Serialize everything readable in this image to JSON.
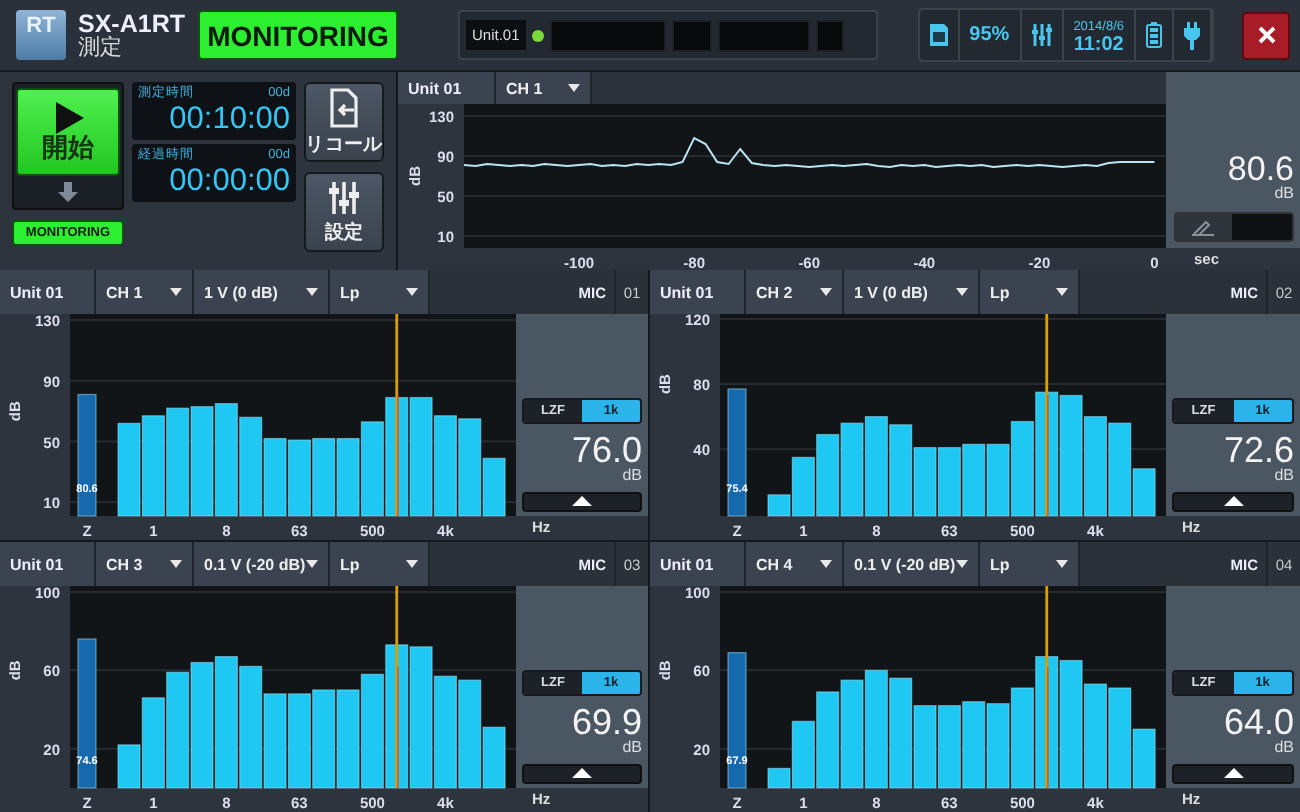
{
  "header": {
    "logo_text": "RT",
    "model": "SX-A1RT",
    "mode": "測定",
    "status_button": "MONITORING",
    "unit_label": "Unit.01",
    "unit_connected": true,
    "storage": "95%",
    "date": "2014/8/6",
    "time": "11:02"
  },
  "control": {
    "start_label": "開始",
    "status_badge": "MONITORING",
    "timers": [
      {
        "label": "測定時間",
        "days": "00d",
        "value": "00:10:00"
      },
      {
        "label": "経過時間",
        "days": "00d",
        "value": "00:00:00"
      }
    ],
    "buttons": [
      {
        "kind": "recall",
        "label": "リコール"
      },
      {
        "kind": "settings",
        "label": "設定"
      }
    ]
  },
  "trend": {
    "unit": "Unit 01",
    "channel": "CH 1",
    "reading": "80.6",
    "reading_unit": "dB",
    "chart_data": {
      "type": "line",
      "ylabel": "dB",
      "xlabel": "sec",
      "xlim": [
        -120,
        2
      ],
      "grid": true,
      "ylim": [
        -2,
        142
      ],
      "yticks": [
        10,
        50,
        90,
        130
      ],
      "xticks": [
        -100,
        -80,
        -60,
        -40,
        -20,
        0
      ],
      "x": [
        -120,
        -118,
        -116,
        -114,
        -112,
        -110,
        -108,
        -106,
        -104,
        -102,
        -100,
        -98,
        -96,
        -94,
        -92,
        -90,
        -88,
        -86,
        -84,
        -82,
        -80,
        -78,
        -76,
        -74,
        -72,
        -70,
        -68,
        -66,
        -64,
        -62,
        -60,
        -58,
        -56,
        -54,
        -52,
        -50,
        -48,
        -46,
        -44,
        -42,
        -40,
        -38,
        -36,
        -34,
        -32,
        -30,
        -28,
        -26,
        -24,
        -22,
        -20,
        -18,
        -16,
        -14,
        -12,
        -10,
        -8,
        -6,
        -4,
        -2,
        0
      ],
      "values": [
        81,
        80,
        82,
        81,
        80,
        81,
        80,
        82,
        81,
        80,
        81,
        82,
        80,
        81,
        80,
        82,
        81,
        82,
        81,
        84,
        108,
        102,
        84,
        82,
        97,
        83,
        81,
        80,
        81,
        80,
        79,
        80,
        81,
        80,
        81,
        82,
        80,
        79,
        81,
        80,
        81,
        79,
        80,
        81,
        80,
        81,
        79,
        80,
        81,
        80,
        81,
        80,
        79,
        80,
        81,
        80,
        83,
        84,
        84,
        84,
        84
      ]
    }
  },
  "panels": [
    {
      "unit": "Unit 01",
      "channel": "CH 1",
      "range": "1 V (0 dB)",
      "weighting": "Lp",
      "input": "MIC",
      "number": "01",
      "filters": [
        {
          "label": "LZF",
          "selected": false
        },
        {
          "label": "1k",
          "selected": true
        }
      ],
      "reading": "76.0",
      "reading_unit": "dB",
      "chart_data": {
        "type": "bar",
        "ylabel": "dB",
        "xlabel": "Hz",
        "ylim": [
          1,
          134
        ],
        "yticks": [
          10,
          50,
          90,
          130
        ],
        "categories": [
          "Z",
          null,
          "1",
          null,
          null,
          "8",
          null,
          null,
          "63",
          null,
          null,
          "500",
          null,
          null,
          "4k",
          null,
          null
        ],
        "values": [
          81,
          62,
          67,
          72,
          73,
          75,
          66,
          52,
          51,
          52,
          52,
          63,
          79,
          79,
          67,
          65,
          39
        ],
        "grid": true,
        "annotations": [
          "80.6"
        ]
      }
    },
    {
      "unit": "Unit 01",
      "channel": "CH 2",
      "range": "1 V (0 dB)",
      "weighting": "Lp",
      "input": "MIC",
      "number": "02",
      "filters": [
        {
          "label": "LZF",
          "selected": false
        },
        {
          "label": "1k",
          "selected": true
        }
      ],
      "reading": "72.6",
      "reading_unit": "dB",
      "chart_data": {
        "type": "bar",
        "ylabel": "dB",
        "xlabel": "Hz",
        "ylim": [
          -1,
          123
        ],
        "yticks": [
          40,
          80,
          120
        ],
        "categories": [
          "Z",
          null,
          "1",
          null,
          null,
          "8",
          null,
          null,
          "63",
          null,
          null,
          "500",
          null,
          null,
          "4k",
          null,
          null
        ],
        "values": [
          77,
          12,
          35,
          49,
          56,
          60,
          55,
          41,
          41,
          43,
          43,
          57,
          75,
          73,
          60,
          56,
          28
        ],
        "grid": true,
        "annotations": [
          "75.4"
        ]
      }
    },
    {
      "unit": "Unit 01",
      "channel": "CH 3",
      "range": "0.1 V (-20 dB)",
      "weighting": "Lp",
      "input": "MIC",
      "number": "03",
      "filters": [
        {
          "label": "LZF",
          "selected": false
        },
        {
          "label": "1k",
          "selected": true
        }
      ],
      "reading": "69.9",
      "reading_unit": "dB",
      "chart_data": {
        "type": "bar",
        "ylabel": "dB",
        "xlabel": "Hz",
        "ylim": [
          0,
          103
        ],
        "yticks": [
          20,
          60,
          100
        ],
        "categories": [
          "Z",
          null,
          "1",
          null,
          null,
          "8",
          null,
          null,
          "63",
          null,
          null,
          "500",
          null,
          null,
          "4k",
          null,
          null
        ],
        "values": [
          76,
          22,
          46,
          59,
          64,
          67,
          62,
          48,
          48,
          50,
          50,
          58,
          73,
          72,
          57,
          55,
          31
        ],
        "grid": true,
        "annotations": [
          "74.6"
        ]
      }
    },
    {
      "unit": "Unit 01",
      "channel": "CH 4",
      "range": "0.1 V (-20 dB)",
      "weighting": "Lp",
      "input": "MIC",
      "number": "04",
      "filters": [
        {
          "label": "LZF",
          "selected": false
        },
        {
          "label": "1k",
          "selected": true
        }
      ],
      "reading": "64.0",
      "reading_unit": "dB",
      "chart_data": {
        "type": "bar",
        "ylabel": "dB",
        "xlabel": "Hz",
        "ylim": [
          0,
          103
        ],
        "yticks": [
          20,
          60,
          100
        ],
        "categories": [
          "Z",
          null,
          "1",
          null,
          null,
          "8",
          null,
          null,
          "63",
          null,
          null,
          "500",
          null,
          null,
          "4k",
          null,
          null
        ],
        "values": [
          69,
          10,
          34,
          49,
          55,
          60,
          56,
          42,
          42,
          44,
          43,
          51,
          67,
          65,
          53,
          51,
          30
        ],
        "grid": true,
        "annotations": [
          "67.9"
        ]
      }
    }
  ]
}
